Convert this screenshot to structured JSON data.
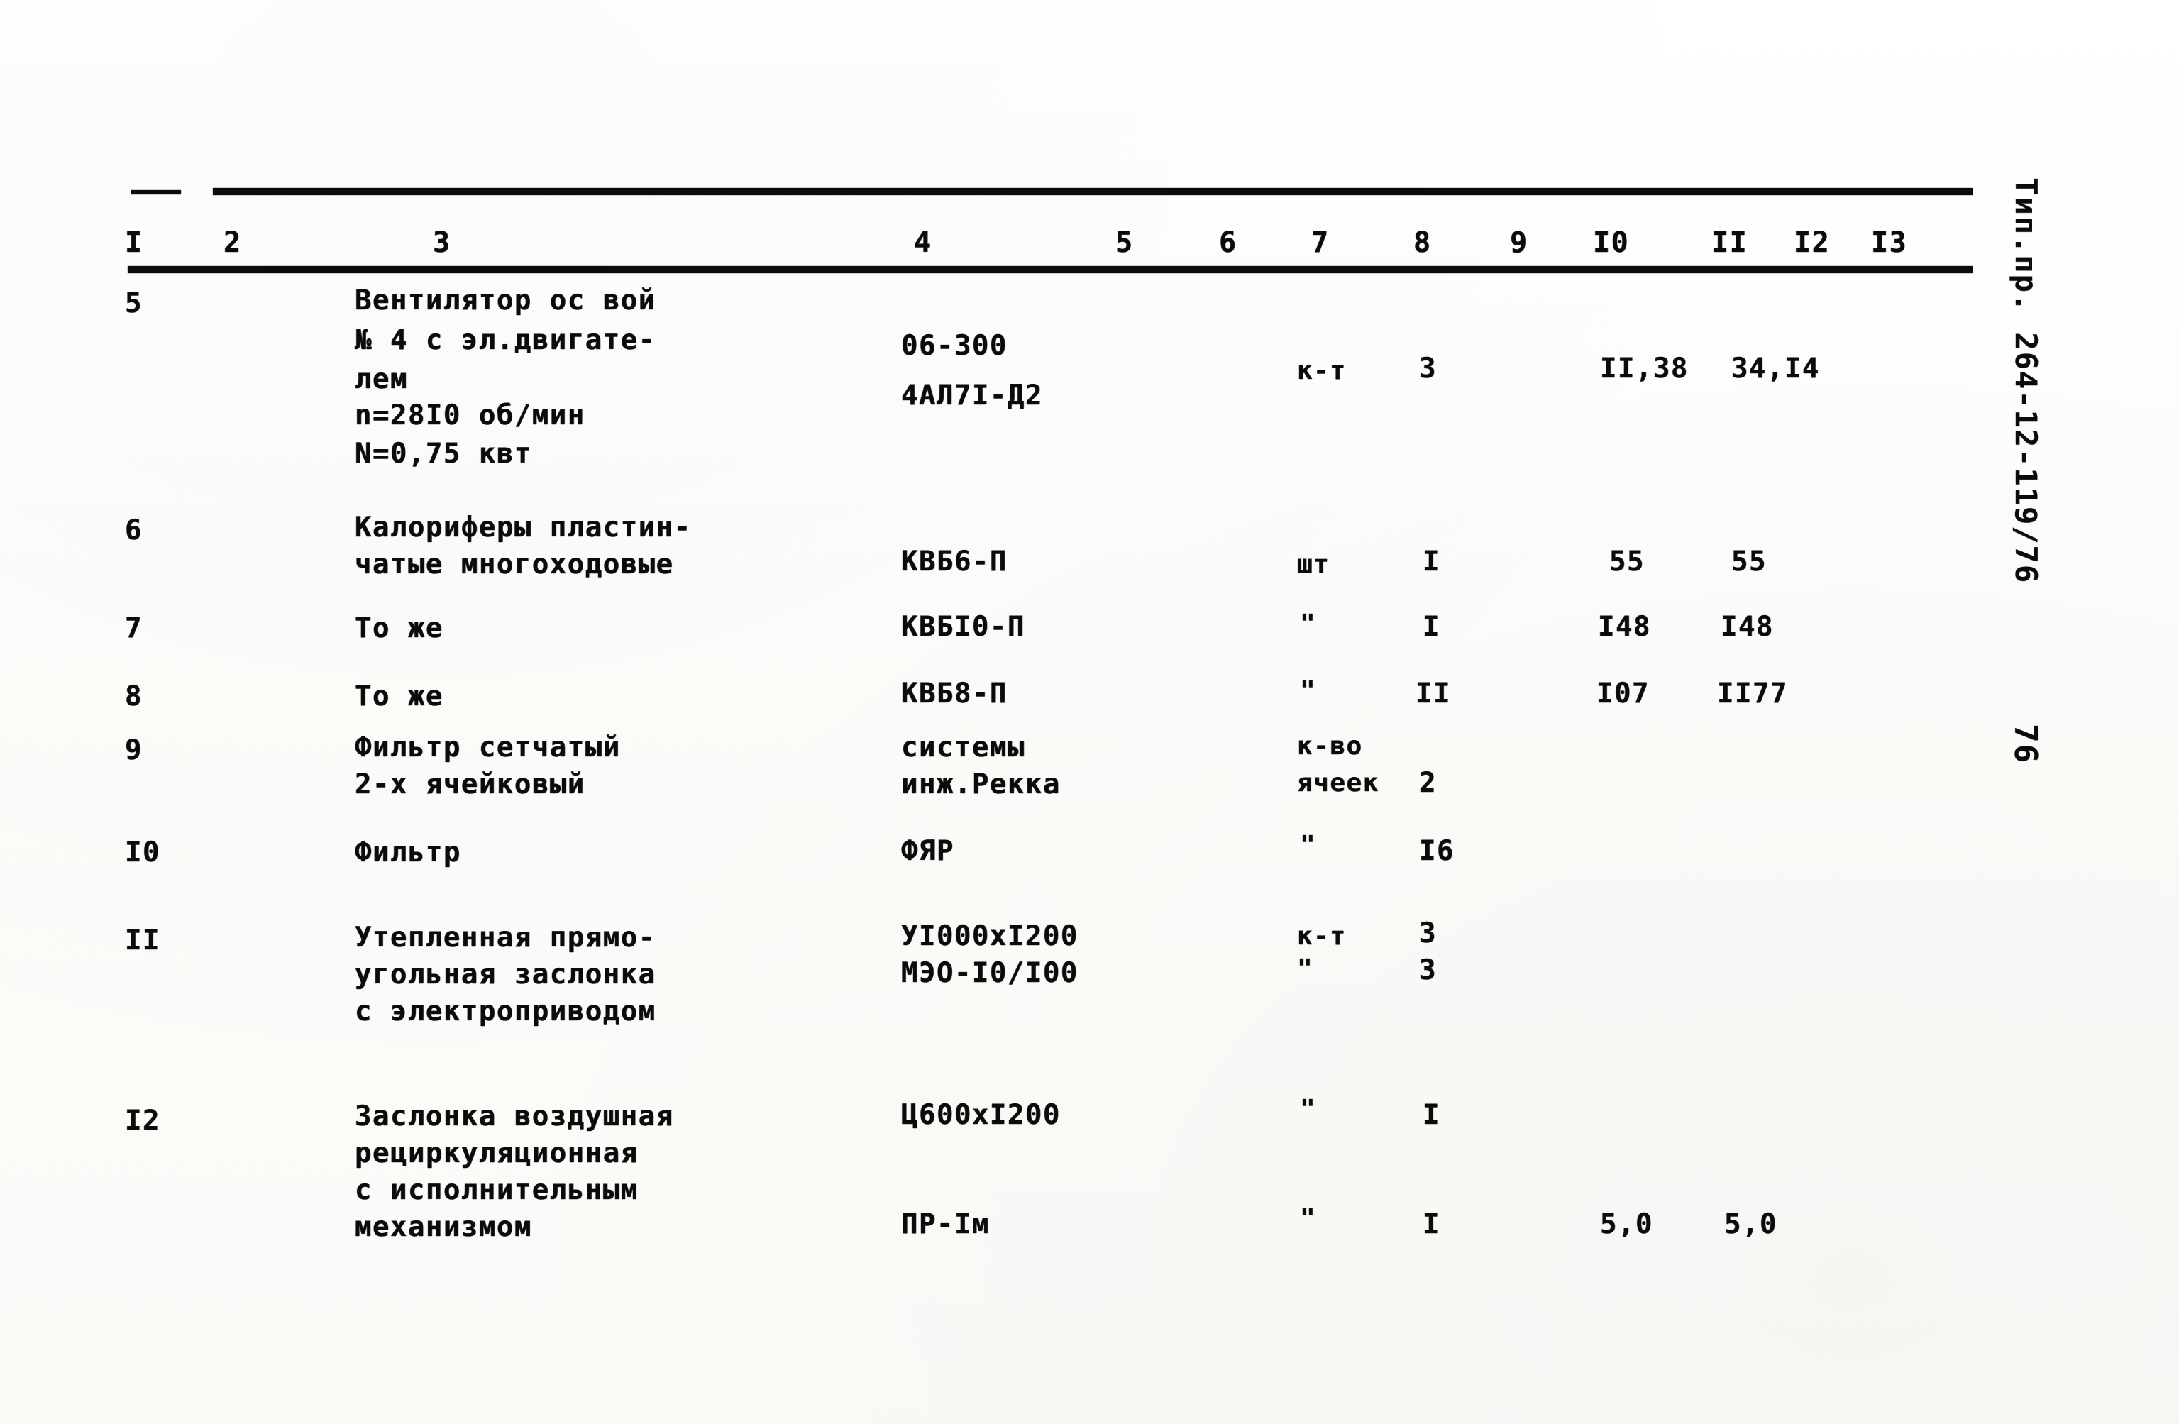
{
  "document": {
    "type": "scanned-typewritten-table",
    "language": "ru",
    "margin_stamp": "Тип.пр. 264-12-119/76",
    "page_number": "76",
    "ink_color": "#0b0b0b",
    "paper_color": "#fdfdfb"
  },
  "table": {
    "column_numbers": [
      "I",
      "2",
      "3",
      "4",
      "5",
      "6",
      "7",
      "8",
      "9",
      "I0",
      "II",
      "I2",
      "I3"
    ],
    "rows": [
      {
        "num": "5",
        "name_lines": [
          "Вентилятор ос вой",
          "№ 4 с эл.двигате-",
          "лем",
          "n=28I0 об/мин",
          "N=0,75 квт"
        ],
        "type_lines": [
          "06-300",
          "4АЛ7I-Д2"
        ],
        "unit_lines": [
          "к-т"
        ],
        "qty_lines": [
          "3"
        ],
        "col10_lines": [
          "II,38"
        ],
        "col11_lines": [
          "34,I4"
        ]
      },
      {
        "num": "6",
        "name_lines": [
          "Калориферы пластин-",
          "чатые многоходовые"
        ],
        "type_lines": [
          "КВБ6-П"
        ],
        "unit_lines": [
          "шт"
        ],
        "qty_lines": [
          "I"
        ],
        "col10_lines": [
          "55"
        ],
        "col11_lines": [
          "55"
        ]
      },
      {
        "num": "7",
        "name_lines": [
          "То же"
        ],
        "type_lines": [
          "КВБI0-П"
        ],
        "unit_lines": [
          "\""
        ],
        "qty_lines": [
          "I"
        ],
        "col10_lines": [
          "I48"
        ],
        "col11_lines": [
          "I48"
        ]
      },
      {
        "num": "8",
        "name_lines": [
          "То же"
        ],
        "type_lines": [
          "КВБ8-П"
        ],
        "unit_lines": [
          "\""
        ],
        "qty_lines": [
          "II"
        ],
        "col10_lines": [
          "I07"
        ],
        "col11_lines": [
          "II77"
        ]
      },
      {
        "num": "9",
        "name_lines": [
          "Фильтр сетчатый",
          "2-х ячейковый"
        ],
        "type_lines": [
          "системы",
          "инж.Рекка"
        ],
        "unit_lines": [
          "к-во",
          "ячеек"
        ],
        "qty_lines": [
          "2"
        ],
        "col10_lines": [],
        "col11_lines": []
      },
      {
        "num": "I0",
        "name_lines": [
          "Фильтр"
        ],
        "type_lines": [
          "ФЯР"
        ],
        "unit_lines": [
          "\""
        ],
        "qty_lines": [
          "I6"
        ],
        "col10_lines": [],
        "col11_lines": []
      },
      {
        "num": "II",
        "name_lines": [
          "Утепленная прямо-",
          "угольная заслонка",
          "с электроприводом"
        ],
        "type_lines": [
          "УI000хI200",
          "МЭО-I0/I00"
        ],
        "unit_lines": [
          "к-т",
          "\""
        ],
        "qty_lines": [
          "3",
          "3"
        ],
        "col10_lines": [],
        "col11_lines": []
      },
      {
        "num": "I2",
        "name_lines": [
          "Заслонка воздушная",
          "рециркуляционная",
          "с исполнительным",
          "механизмом"
        ],
        "type_lines": [
          "Ц600хI200",
          "ПР-Iм"
        ],
        "unit_lines": [
          "\"",
          "\""
        ],
        "qty_lines": [
          "I",
          "I"
        ],
        "col10_lines": [
          "5,0"
        ],
        "col11_lines": [
          "5,0"
        ]
      }
    ]
  }
}
